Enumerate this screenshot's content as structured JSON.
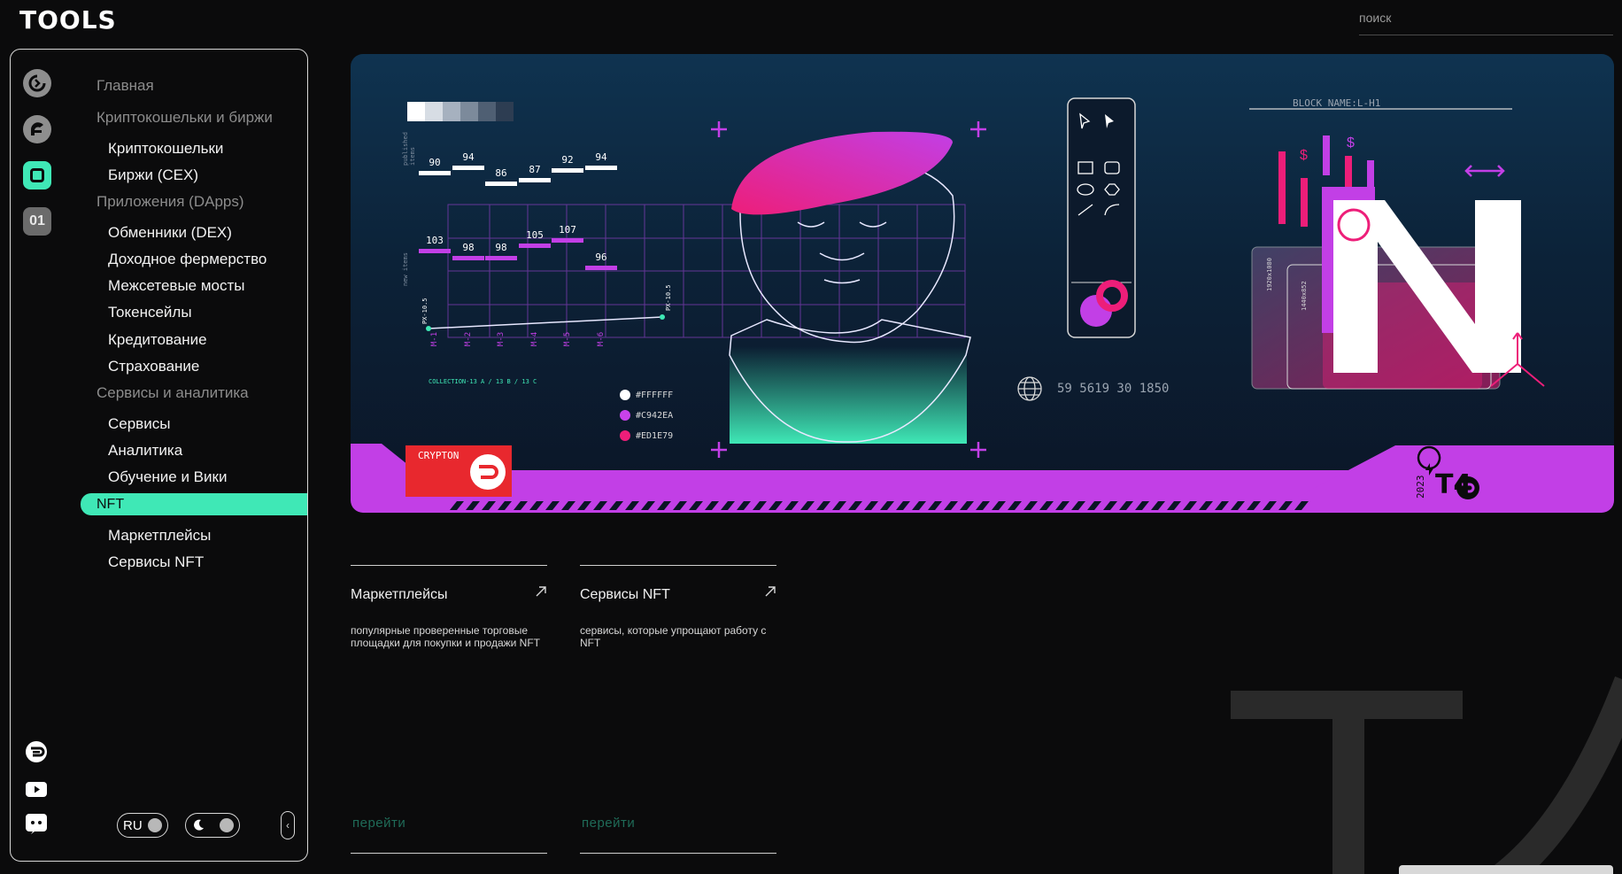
{
  "app": {
    "logo": "TOOLS"
  },
  "search": {
    "placeholder": "поиск"
  },
  "sidebar": {
    "rail_icons": [
      "refresh-logo-icon",
      "crypton-logo-icon",
      "square-app-icon",
      "01-icon"
    ],
    "rail_01_text": "01",
    "sections": [
      {
        "label": "Главная"
      },
      {
        "label": "Криптокошельки и биржи",
        "items": [
          "Криптокошельки",
          "Биржи (CEX)"
        ]
      },
      {
        "label": "Приложения (DApps)",
        "items": [
          "Обменники (DEX)",
          "Доходное фермерство",
          "Межсетевые мосты",
          "Токенсейлы",
          "Кредитование",
          "Страхование"
        ]
      },
      {
        "label": "Сервисы и аналитика",
        "items": [
          "Сервисы",
          "Аналитика",
          "Обучение и Вики"
        ]
      },
      {
        "label": "NFT",
        "active": true,
        "items": [
          "Маркетплейсы",
          "Сервисы NFT"
        ]
      }
    ],
    "lang": "RU",
    "social_icons": [
      "crypton-icon",
      "youtube-icon",
      "discord-icon"
    ]
  },
  "banner": {
    "chart_top_values": [
      "90",
      "94",
      "86",
      "87",
      "92",
      "94"
    ],
    "chart_bottom_values": [
      "103",
      "98",
      "98",
      "105",
      "107",
      "96"
    ],
    "chart_x_labels": [
      "M-1",
      "M-2",
      "M-3",
      "M-4",
      "M-5",
      "M-6"
    ],
    "side_label_top": "published items",
    "side_label_bottom": "new items",
    "point_label_left": "PX-10.5",
    "point_label_right": "PX-10.5",
    "collection_text": "COLLECTION-13 A / 13 B / 13 C",
    "swatches": [
      {
        "hex": "#FFFFFF",
        "label": "#FFFFFF"
      },
      {
        "hex": "#C942EA",
        "label": "#C942EA"
      },
      {
        "hex": "#ED1E79",
        "label": "#ED1E79"
      }
    ],
    "block_name": "BLOCK NAME:L-H1",
    "globe_text": "59 5619 30 1850",
    "crypton_label": "CRYPTON",
    "year": "2023",
    "t4_label": "T4",
    "dim_label_1": "1920x1080",
    "dim_label_2": "1440x852",
    "accent_magenta": "#c23fe6",
    "accent_pink": "#ed1e79",
    "accent_teal": "#3fe8b6"
  },
  "cards": [
    {
      "title": "Маркетплейсы",
      "desc": "популярные проверенные торговые площадки для покупки и продажи NFT",
      "go": "перейти"
    },
    {
      "title": "Сервисы NFT",
      "desc": "сервисы, которые упрощают работу с NFT",
      "go": "перейти"
    }
  ]
}
